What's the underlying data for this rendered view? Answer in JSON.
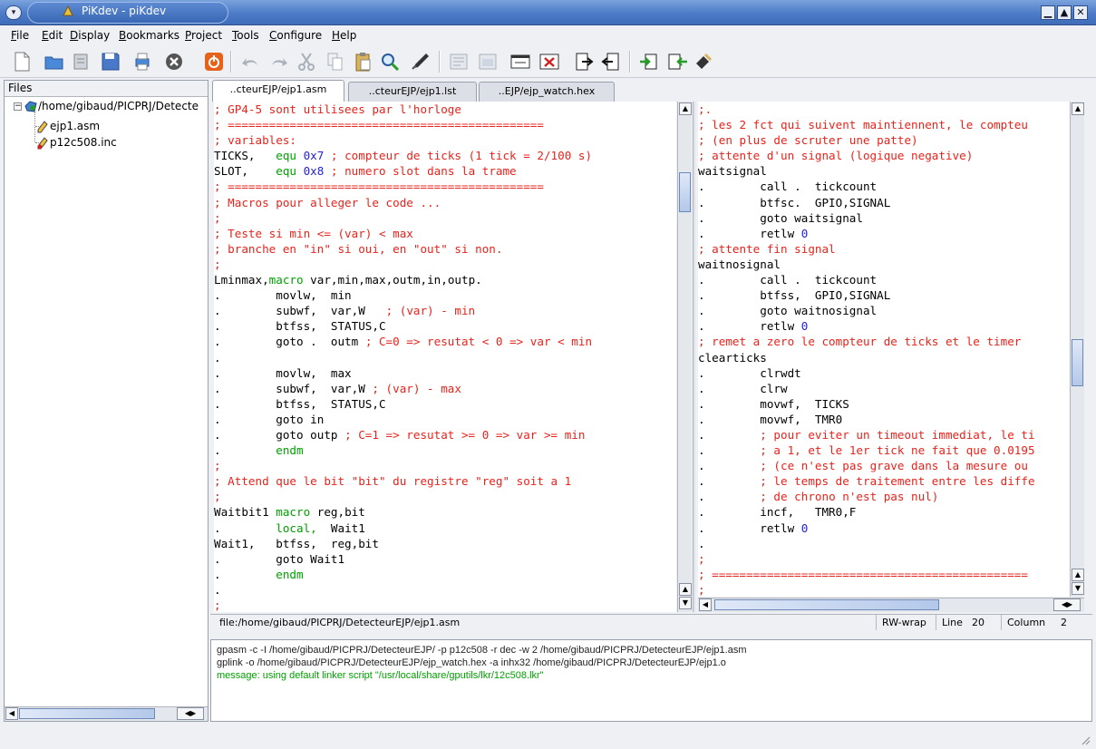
{
  "window": {
    "title": "PiKdev - piKdev",
    "menu_glyph": "▾",
    "minimize": "▁",
    "maximize": "▲",
    "close": "✕"
  },
  "menu": {
    "items": [
      {
        "u": "F",
        "rest": "ile"
      },
      {
        "u": "E",
        "rest": "dit"
      },
      {
        "u": "D",
        "rest": "isplay"
      },
      {
        "u": "B",
        "rest": "ookmarks"
      },
      {
        "u": "P",
        "rest": "roject"
      },
      {
        "u": "T",
        "rest": "ools"
      },
      {
        "u": "C",
        "rest": "onfigure"
      },
      {
        "u": "H",
        "rest": "elp"
      }
    ]
  },
  "toolbar": {
    "icons": [
      "new-file-icon",
      "open-project-icon",
      "close-project-icon",
      "save-icon",
      "print-icon",
      "stop-icon",
      "power-icon",
      "undo-icon",
      "redo-icon",
      "cut-icon",
      "copy-icon",
      "paste-icon",
      "find-icon",
      "replace-icon",
      "build-icon",
      "compile-icon",
      "window-icon",
      "close-window-icon",
      "step-in-icon",
      "step-out-icon",
      "program-device-icon",
      "read-device-icon",
      "erase-device-icon"
    ]
  },
  "files": {
    "header": "Files",
    "root": "/home/gibaud/PICPRJ/Detecte",
    "expander": "−",
    "children": [
      {
        "name": "ejp1.asm"
      },
      {
        "name": "p12c508.inc"
      }
    ]
  },
  "tabs": [
    {
      "label": "..cteurEJP/ejp1.asm",
      "active": true
    },
    {
      "label": "..cteurEJP/ejp1.lst",
      "active": false
    },
    {
      "label": "..EJP/ejp_watch.hex",
      "active": false
    }
  ],
  "editor_left": {
    "lines": [
      [
        {
          "t": "; GP4-5 sont utilisees par l'horloge",
          "c": "c-comment"
        }
      ],
      [
        {
          "t": "; ==============================================",
          "c": "c-comment"
        }
      ],
      [
        {
          "t": "; variables:",
          "c": "c-comment"
        }
      ],
      [
        {
          "t": "TICKS,   "
        },
        {
          "t": "equ",
          "c": "c-kw"
        },
        {
          "t": " 0x7",
          "c": "c-num"
        },
        {
          "t": " ; compteur de ticks (1 tick = 2/100 s)",
          "c": "c-comment"
        }
      ],
      [
        {
          "t": "SLOT,    "
        },
        {
          "t": "equ",
          "c": "c-kw"
        },
        {
          "t": " 0x8",
          "c": "c-num"
        },
        {
          "t": " ; numero slot dans la trame",
          "c": "c-comment"
        }
      ],
      [
        {
          "t": "; ==============================================",
          "c": "c-comment"
        }
      ],
      [
        {
          "t": "; Macros pour alleger le code ...",
          "c": "c-comment"
        }
      ],
      [
        {
          "t": ";",
          "c": "c-comment"
        }
      ],
      [
        {
          "t": "; Teste si min <= (var) < max",
          "c": "c-comment"
        }
      ],
      [
        {
          "t": "; branche en \"in\" si oui, en \"out\" si non.",
          "c": "c-comment"
        }
      ],
      [
        {
          "t": ";",
          "c": "c-comment"
        }
      ],
      [
        {
          "t": "Lminmax,"
        },
        {
          "t": "macro",
          "c": "c-kw"
        },
        {
          "t": " var,min,max,outm,in,outp."
        }
      ],
      [
        {
          "t": ".        movlw,  min"
        }
      ],
      [
        {
          "t": ".        subwf,  var,W  "
        },
        {
          "t": " ; (var) - min",
          "c": "c-comment"
        }
      ],
      [
        {
          "t": ".        btfss,  STATUS,C"
        }
      ],
      [
        {
          "t": ".        goto .  outm "
        },
        {
          "t": "; C=0 => resutat < 0 => var < min",
          "c": "c-comment"
        }
      ],
      [
        {
          "t": "."
        }
      ],
      [
        {
          "t": ".        movlw,  max"
        }
      ],
      [
        {
          "t": ".        subwf,  var,W "
        },
        {
          "t": "; (var) - max",
          "c": "c-comment"
        }
      ],
      [
        {
          "t": ".        btfss,  STATUS,C"
        }
      ],
      [
        {
          "t": ".        goto in"
        }
      ],
      [
        {
          "t": ".        goto outp "
        },
        {
          "t": "; C=1 => resutat >= 0 => var >= min",
          "c": "c-comment"
        }
      ],
      [
        {
          "t": ".        "
        },
        {
          "t": "endm",
          "c": "c-kw"
        }
      ],
      [
        {
          "t": ";",
          "c": "c-comment"
        }
      ],
      [
        {
          "t": "; Attend que le bit \"bit\" du registre \"reg\" soit a 1",
          "c": "c-comment"
        }
      ],
      [
        {
          "t": ";",
          "c": "c-comment"
        }
      ],
      [
        {
          "t": "Waitbit1 "
        },
        {
          "t": "macro",
          "c": "c-kw"
        },
        {
          "t": " reg,bit"
        }
      ],
      [
        {
          "t": ".        "
        },
        {
          "t": "local,",
          "c": "c-kw"
        },
        {
          "t": "  Wait1"
        }
      ],
      [
        {
          "t": "Wait1,   btfss,  reg,bit"
        }
      ],
      [
        {
          "t": ".        goto Wait1"
        }
      ],
      [
        {
          "t": ".        "
        },
        {
          "t": "endm",
          "c": "c-kw"
        }
      ],
      [
        {
          "t": "."
        }
      ],
      [
        {
          "t": ";",
          "c": "c-comment"
        }
      ]
    ]
  },
  "editor_right": {
    "lines": [
      [
        {
          "t": ";.",
          "c": "c-comment"
        }
      ],
      [
        {
          "t": "; les 2 fct qui suivent maintiennent, le compteu",
          "c": "c-comment"
        }
      ],
      [
        {
          "t": "; (en plus de scruter une patte)",
          "c": "c-comment"
        }
      ],
      [
        {
          "t": "; attente d'un signal (logique negative)",
          "c": "c-comment"
        }
      ],
      [
        {
          "t": "waitsignal"
        }
      ],
      [
        {
          "t": ".        call .  tickcount"
        }
      ],
      [
        {
          "t": ".        btfsc.  GPIO,SIGNAL"
        }
      ],
      [
        {
          "t": ".        goto waitsignal"
        }
      ],
      [
        {
          "t": ".        retlw "
        },
        {
          "t": "0",
          "c": "c-num"
        }
      ],
      [
        {
          "t": "; attente fin signal",
          "c": "c-comment"
        }
      ],
      [
        {
          "t": "waitnosignal"
        }
      ],
      [
        {
          "t": ".        call .  tickcount"
        }
      ],
      [
        {
          "t": ".        btfss,  GPIO,SIGNAL"
        }
      ],
      [
        {
          "t": ".        goto waitnosignal"
        }
      ],
      [
        {
          "t": ".        retlw "
        },
        {
          "t": "0",
          "c": "c-num"
        }
      ],
      [
        {
          "t": "; remet a zero le compteur de ticks et le timer",
          "c": "c-comment"
        }
      ],
      [
        {
          "t": "clearticks"
        }
      ],
      [
        {
          "t": ".        clrwdt"
        }
      ],
      [
        {
          "t": ".        clrw"
        }
      ],
      [
        {
          "t": ".        movwf,  TICKS"
        }
      ],
      [
        {
          "t": ".        movwf,  TMR0"
        }
      ],
      [
        {
          "t": ".        ",
          "c": ""
        },
        {
          "t": "; pour eviter un timeout immediat, le ti",
          "c": "c-comment"
        }
      ],
      [
        {
          "t": ".        ",
          "c": ""
        },
        {
          "t": "; a 1, et le 1er tick ne fait que 0.0195",
          "c": "c-comment"
        }
      ],
      [
        {
          "t": ".        ",
          "c": ""
        },
        {
          "t": "; (ce n'est pas grave dans la mesure ou",
          "c": "c-comment"
        }
      ],
      [
        {
          "t": ".        ",
          "c": ""
        },
        {
          "t": "; le temps de traitement entre les diffe",
          "c": "c-comment"
        }
      ],
      [
        {
          "t": ".        ",
          "c": ""
        },
        {
          "t": "; de chrono n'est pas nul)",
          "c": "c-comment"
        }
      ],
      [
        {
          "t": ".        incf,   TMR0,F"
        }
      ],
      [
        {
          "t": ".        retlw "
        },
        {
          "t": "0",
          "c": "c-num"
        }
      ],
      [
        {
          "t": "."
        }
      ],
      [
        {
          "t": ";",
          "c": "c-comment"
        }
      ],
      [
        {
          "t": "; ==============================================",
          "c": "c-comment"
        }
      ],
      [
        {
          "t": ";",
          "c": "c-comment"
        }
      ]
    ]
  },
  "status": {
    "path": "file:/home/gibaud/PICPRJ/DetecteurEJP/ejp1.asm",
    "mode": "RW-wrap",
    "line_label": "Line",
    "line_value": "20",
    "column_label": "Column",
    "column_value": "2"
  },
  "output": {
    "lines": [
      {
        "text": "gpasm -c -I /home/gibaud/PICPRJ/DetecteurEJP/ -p p12c508 -r dec -w 2 /home/gibaud/PICPRJ/DetecteurEJP/ejp1.asm",
        "kind": "cmd"
      },
      {
        "text": "gplink -o /home/gibaud/PICPRJ/DetecteurEJP/ejp_watch.hex -a inhx32 /home/gibaud/PICPRJ/DetecteurEJP/ejp1.o",
        "kind": "cmd"
      },
      {
        "text": "message: using default linker script \"/usr/local/share/gputils/lkr/12c508.lkr\"",
        "kind": "msg"
      }
    ]
  },
  "colors": {
    "comment": "#e8231c",
    "keyword": "#00a000",
    "number": "#2020e0",
    "titlebar": "#4d7bc8"
  }
}
